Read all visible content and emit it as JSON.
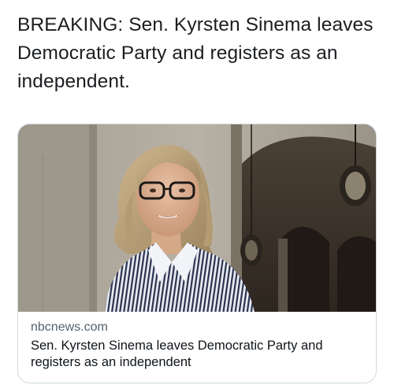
{
  "tweet": {
    "text": "BREAKING: Sen. Kyrsten Sinema leaves Democratic Party and registers as an independent."
  },
  "link_card": {
    "domain": "nbcnews.com",
    "title": "Sen. Kyrsten Sinema leaves Democratic Party and registers as an independent"
  }
}
